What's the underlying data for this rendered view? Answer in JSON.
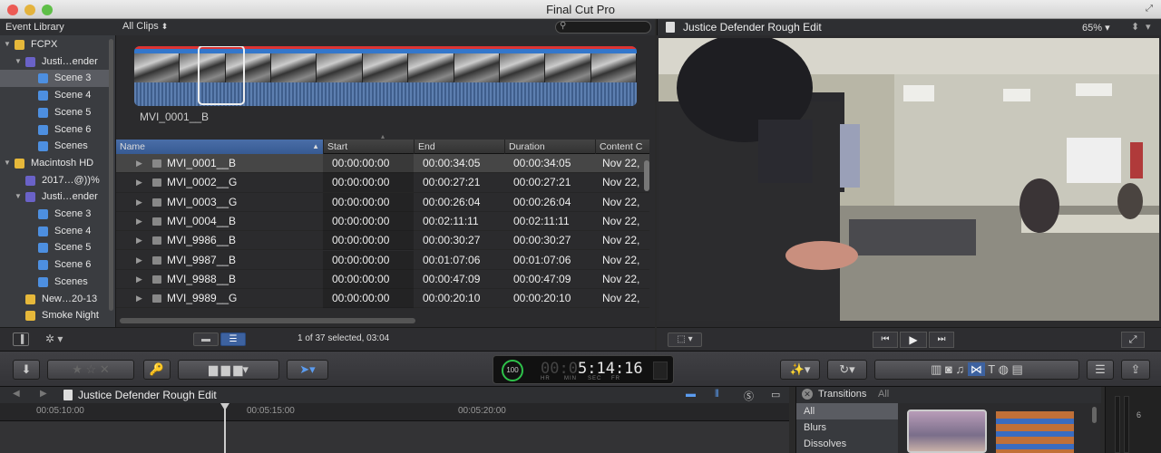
{
  "app": {
    "title": "Final Cut Pro"
  },
  "library": {
    "header": "Event Library",
    "items": [
      {
        "label": "FCPX",
        "indent": 0,
        "type": "drive",
        "expanded": true
      },
      {
        "label": "Justi…ender",
        "indent": 1,
        "type": "event",
        "expanded": true
      },
      {
        "label": "Scene 3",
        "indent": 2,
        "type": "keyword",
        "selected": true
      },
      {
        "label": "Scene 4",
        "indent": 2,
        "type": "keyword"
      },
      {
        "label": "Scene 5",
        "indent": 2,
        "type": "keyword"
      },
      {
        "label": "Scene 6",
        "indent": 2,
        "type": "keyword"
      },
      {
        "label": "Scenes",
        "indent": 2,
        "type": "keyword"
      },
      {
        "label": "Macintosh HD",
        "indent": 0,
        "type": "home",
        "expanded": true
      },
      {
        "label": "2017…@))%",
        "indent": 1,
        "type": "event"
      },
      {
        "label": "Justi…ender",
        "indent": 1,
        "type": "event",
        "expanded": true
      },
      {
        "label": "Scene 3",
        "indent": 2,
        "type": "keyword"
      },
      {
        "label": "Scene 4",
        "indent": 2,
        "type": "keyword"
      },
      {
        "label": "Scene 5",
        "indent": 2,
        "type": "keyword"
      },
      {
        "label": "Scene 6",
        "indent": 2,
        "type": "keyword"
      },
      {
        "label": "Scenes",
        "indent": 2,
        "type": "keyword"
      },
      {
        "label": "New…20-13",
        "indent": 1,
        "type": "event-star"
      },
      {
        "label": "Smoke Night",
        "indent": 1,
        "type": "event-star"
      }
    ]
  },
  "browser": {
    "filter": "All Clips",
    "filmstrip_label": "MVI_0001__B",
    "columns": [
      "Name",
      "Start",
      "End",
      "Duration",
      "Content C"
    ],
    "rows": [
      {
        "name": "MVI_0001__B",
        "start": "00:00:00:00",
        "end": "00:00:34:05",
        "duration": "00:00:34:05",
        "content": "Nov 22,",
        "selected": true
      },
      {
        "name": "MVI_0002__G",
        "start": "00:00:00:00",
        "end": "00:00:27:21",
        "duration": "00:00:27:21",
        "content": "Nov 22,"
      },
      {
        "name": "MVI_0003__G",
        "start": "00:00:00:00",
        "end": "00:00:26:04",
        "duration": "00:00:26:04",
        "content": "Nov 22,"
      },
      {
        "name": "MVI_0004__B",
        "start": "00:00:00:00",
        "end": "00:02:11:11",
        "duration": "00:02:11:11",
        "content": "Nov 22,"
      },
      {
        "name": "MVI_9986__B",
        "start": "00:00:00:00",
        "end": "00:00:30:27",
        "duration": "00:00:30:27",
        "content": "Nov 22,"
      },
      {
        "name": "MVI_9987__B",
        "start": "00:00:00:00",
        "end": "00:01:07:06",
        "duration": "00:01:07:06",
        "content": "Nov 22,"
      },
      {
        "name": "MVI_9988__B",
        "start": "00:00:00:00",
        "end": "00:00:47:09",
        "duration": "00:00:47:09",
        "content": "Nov 22,"
      },
      {
        "name": "MVI_9989__G",
        "start": "00:00:00:00",
        "end": "00:00:20:10",
        "duration": "00:00:20:10",
        "content": "Nov 22,"
      }
    ],
    "status": "1 of 37 selected, 03:04"
  },
  "viewer": {
    "title": "Justice Defender Rough Edit",
    "zoom": "65%"
  },
  "toolbar": {
    "timecode_dim": "00:0",
    "timecode": "5:14:16",
    "tc_units": [
      "HR",
      "MIN",
      "SEC",
      "FR"
    ],
    "percent": "100"
  },
  "timeline": {
    "title": "Justice Defender Rough Edit",
    "ruler": [
      "00:05:10:00",
      "00:05:15:00",
      "00:05:20:00"
    ]
  },
  "transitions": {
    "title": "Transitions",
    "filter": "All",
    "categories": [
      "All",
      "Blurs",
      "Dissolves"
    ]
  },
  "meter": {
    "label": "6"
  },
  "colors": {
    "selection_blue": "#3d62a0",
    "accent_green": "#2ec24a"
  }
}
